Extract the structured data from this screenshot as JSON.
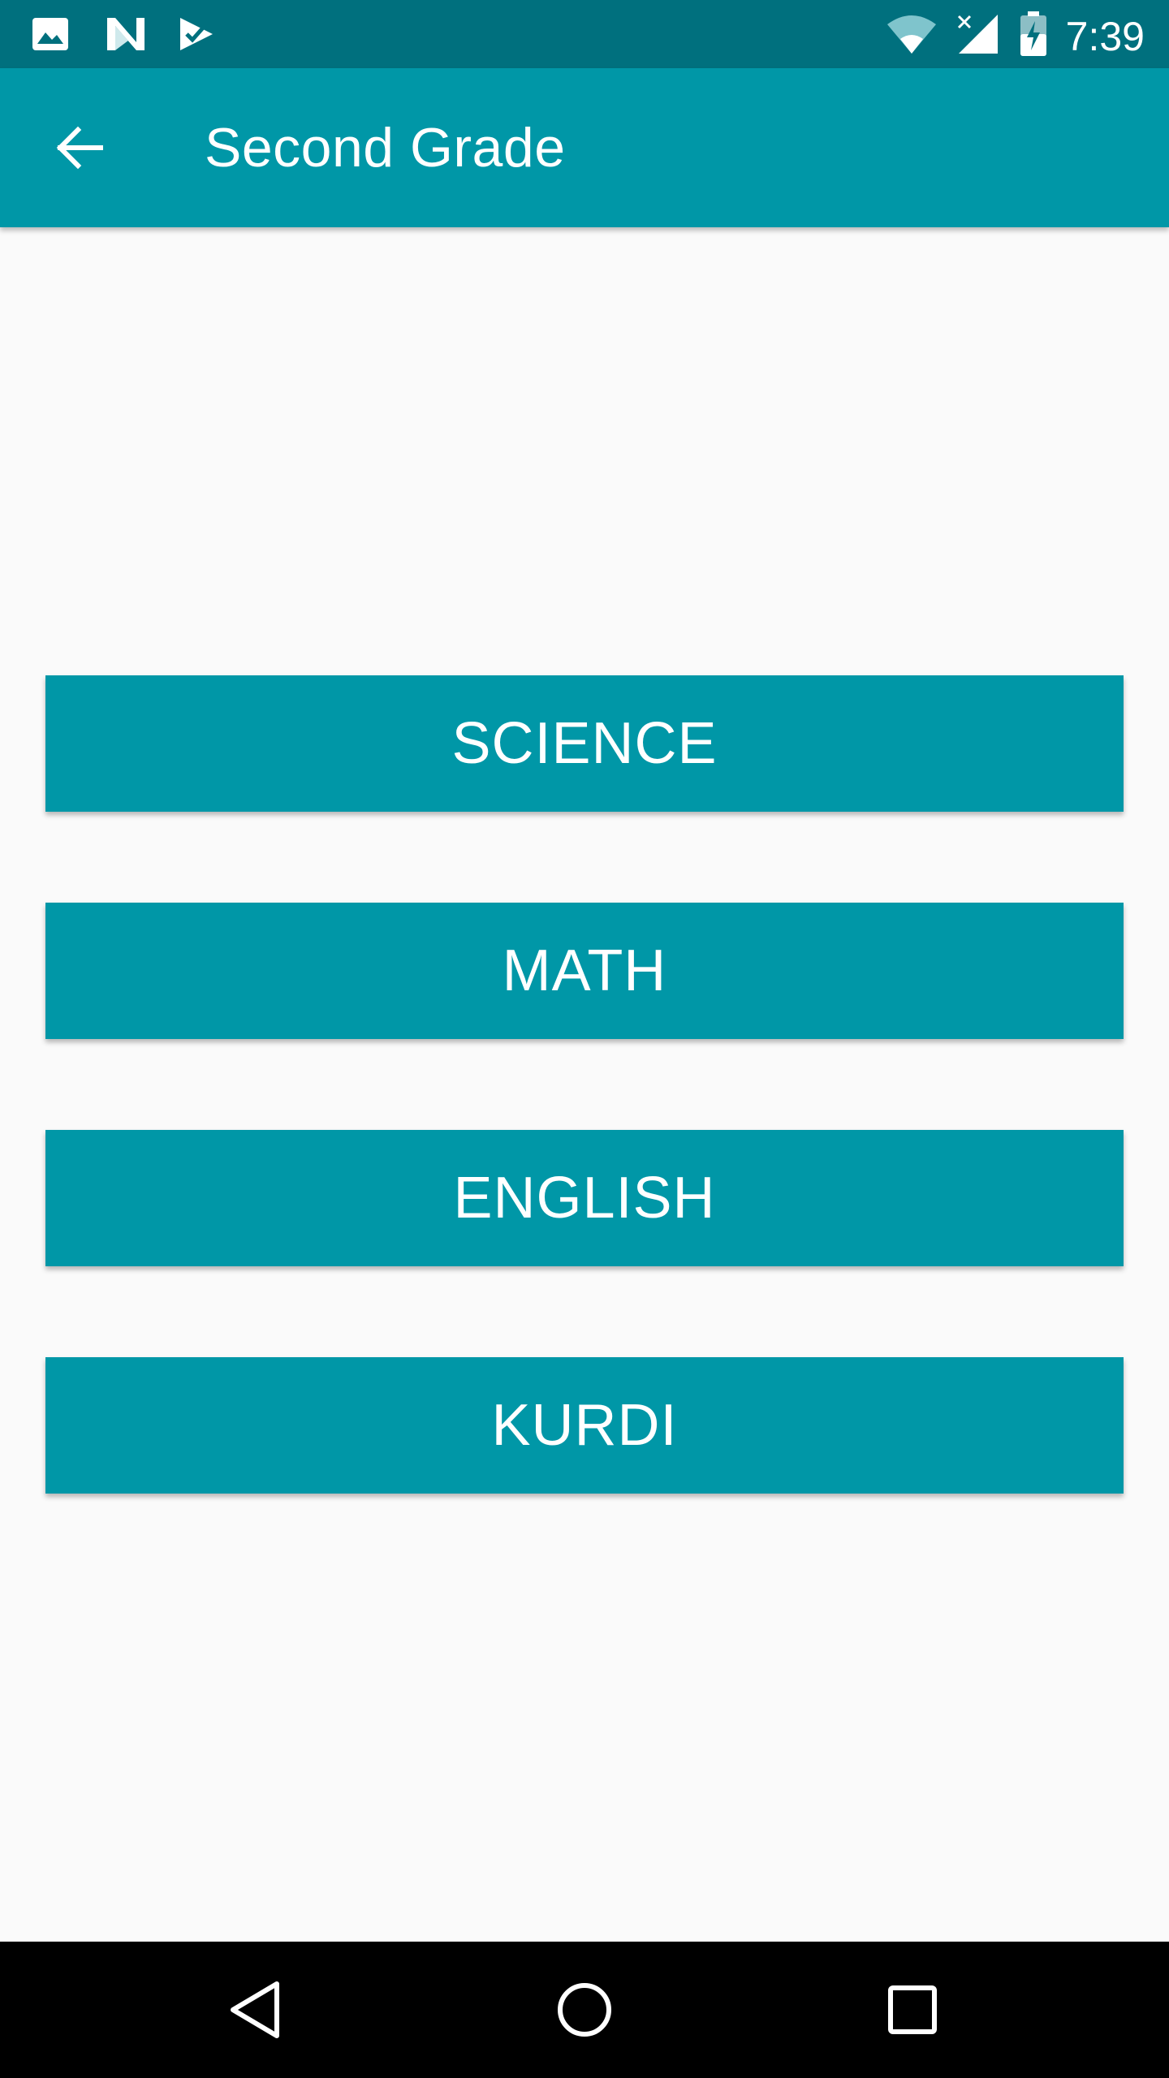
{
  "status_bar": {
    "time": "7:39",
    "left_icons": [
      "image-icon",
      "n-logo-icon",
      "check-badge-icon"
    ],
    "right_icons": [
      "wifi-icon",
      "signal-no-service-icon",
      "battery-charging-icon"
    ]
  },
  "app_bar": {
    "title": "Second Grade",
    "back_icon": "arrow-back-icon"
  },
  "subjects": [
    {
      "label": "SCIENCE"
    },
    {
      "label": "MATH"
    },
    {
      "label": "ENGLISH"
    },
    {
      "label": "KURDI"
    }
  ],
  "nav_bar": {
    "icons": [
      "nav-back-icon",
      "nav-home-icon",
      "nav-recents-icon"
    ]
  },
  "colors": {
    "status_bar": "#00707e",
    "primary": "#0097a7",
    "background": "#fafafa",
    "nav_bar": "#000000"
  }
}
